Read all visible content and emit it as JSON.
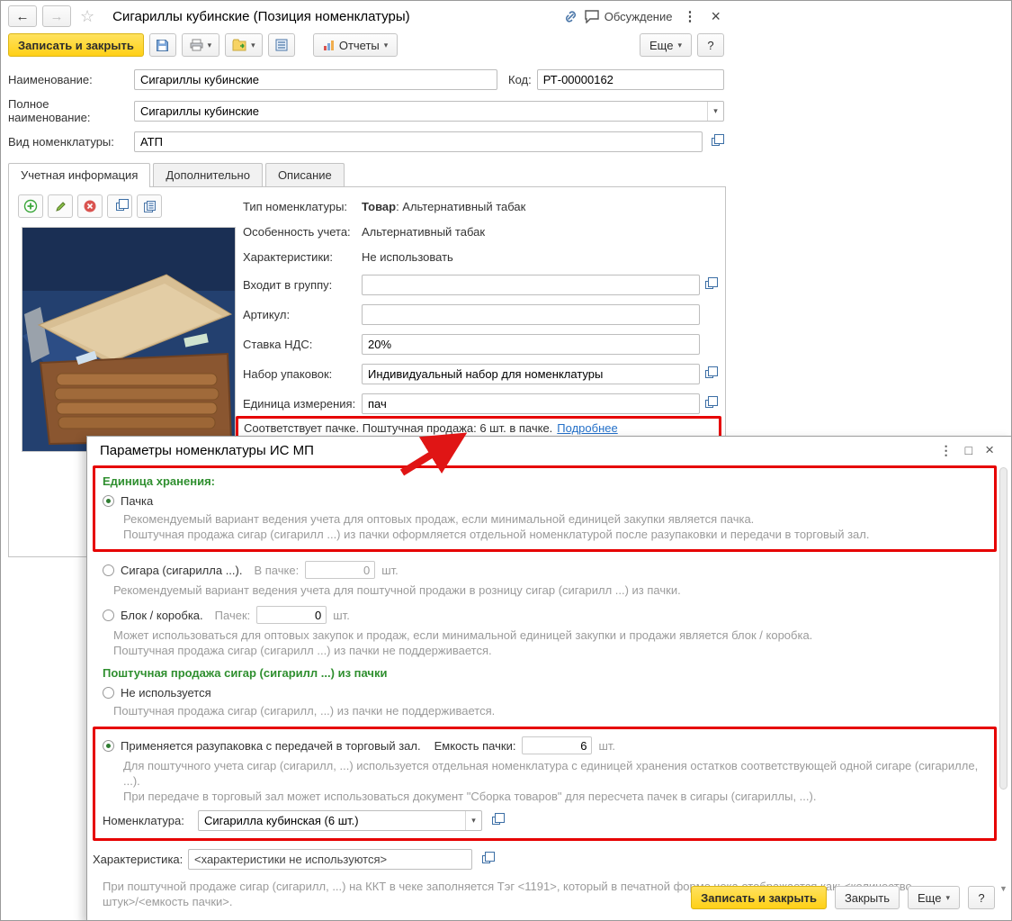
{
  "icons": {
    "back": "←",
    "forward": "→",
    "star": "☆",
    "menu": "⋮",
    "close": "×",
    "maximize": "□",
    "caret_down": "▾",
    "scroll_down": "▼"
  },
  "main": {
    "title": "Сигариллы кубинские (Позиция номенклатуры)",
    "discussion": "Обсуждение",
    "toolbar": {
      "save_close": "Записать и закрыть",
      "reports": "Отчеты",
      "more": "Еще",
      "help": "?"
    },
    "fields": {
      "name_label": "Наименование:",
      "name_value": "Сигариллы кубинские",
      "code_label": "Код:",
      "code_value": "РТ-00000162",
      "full_label": "Полное наименование:",
      "full_value": "Сигариллы кубинские",
      "kind_label": "Вид номенклатуры:",
      "kind_value": "АТП"
    },
    "tabs": {
      "accounting": "Учетная информация",
      "additional": "Дополнительно",
      "description": "Описание"
    },
    "panel": {
      "type_label": "Тип номенклатуры:",
      "type_value_bold": "Товар",
      "type_value_rest": ": Альтернативный табак",
      "feature_label": "Особенность учета:",
      "feature_value": "Альтернативный табак",
      "chars_label": "Характеристики:",
      "chars_value": "Не использовать",
      "group_label": "Входит в группу:",
      "group_value": "",
      "article_label": "Артикул:",
      "article_value": "",
      "vat_label": "Ставка НДС:",
      "vat_value": "20%",
      "pack_set_label": "Набор упаковок:",
      "pack_set_value": "Индивидуальный набор для номенклатуры",
      "unit_label": "Единица измерения:",
      "unit_value": "пач",
      "note_text": "Соответствует пачке. Поштучная продажа: 6 шт. в пачке.",
      "note_link": "Подробнее"
    }
  },
  "dialog": {
    "title": "Параметры номенклатуры ИС МП",
    "storage_header": "Единица хранения:",
    "opt_pack": "Пачка",
    "pack_desc": "Рекомендуемый вариант ведения учета для оптовых продаж, если минимальной единицей закупки является пачка.\nПоштучная продажа сигар (сигарилл ...) из пачки оформляется отдельной номенклатурой после разупаковки и передачи в торговый зал.",
    "opt_cigar": "Сигара (сигарилла ...).",
    "cigar_qty_label": "В пачке:",
    "cigar_qty_value": "0",
    "cigar_qty_unit": "шт.",
    "cigar_desc": "Рекомендуемый вариант ведения учета для поштучной продажи в розницу сигар (сигарилл ...) из пачки.",
    "opt_block": "Блок / коробка.",
    "block_qty_label": "Пачек:",
    "block_qty_value": "0",
    "block_qty_unit": "шт.",
    "block_desc": "Может использоваться для оптовых закупок и продаж, если минимальной единицей закупки и продажи является блок / коробка.\nПоштучная продажа сигар (сигарилл ...) из пачки не поддерживается.",
    "retail_header": "Поштучная продажа сигар (сигарилл ...) из пачки",
    "opt_not_used": "Не используется",
    "not_used_desc": "Поштучная продажа сигар (сигарилл, ...) из пачки не поддерживается.",
    "opt_unpack": "Применяется разупаковка с передачей в торговый зал.",
    "capacity_label": "Емкость пачки:",
    "capacity_value": "6",
    "capacity_unit": "шт.",
    "unpack_desc": "Для поштучного учета сигар (сигарилл, ...) используется отдельная номенклатура с единицей хранения остатков соответствующей одной сигаре (сигарилле, ...).\nПри передаче в торговый зал может использоваться документ \"Сборка товаров\" для пересчета пачек в сигары (сигариллы, ...).",
    "nomenclature_label": "Номенклатура:",
    "nomenclature_value": "Сигарилла кубинская (6 шт.)",
    "characteristic_label": "Характеристика:",
    "characteristic_value": "<характеристики не используются>",
    "footer_note": "При поштучной продаже сигар (сигарилл, ...) на ККТ в чеке заполняется Тэг <1191>, который в печатной форме чека отображается как: <количество штук>/<емкость пачки>.",
    "buttons": {
      "save_close": "Записать и закрыть",
      "close": "Закрыть",
      "more": "Еще",
      "help": "?"
    }
  }
}
